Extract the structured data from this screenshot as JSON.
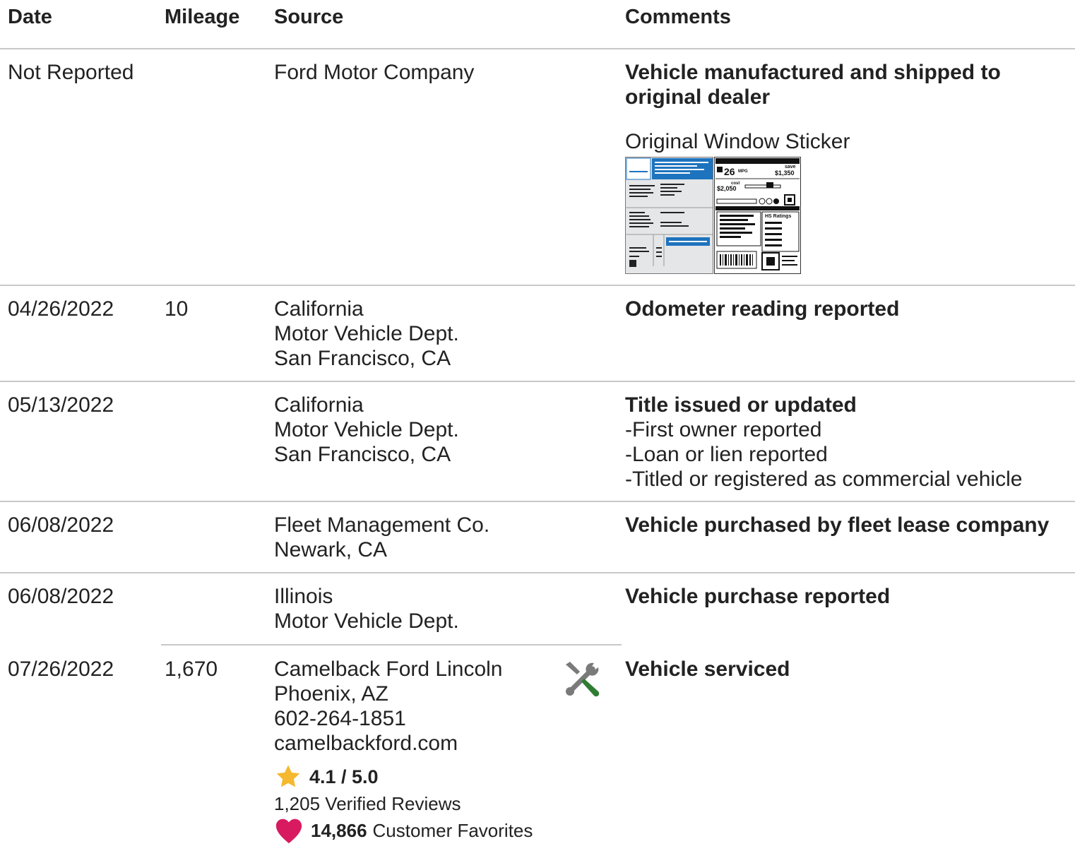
{
  "headers": {
    "date": "Date",
    "mileage": "Mileage",
    "source": "Source",
    "comments": "Comments"
  },
  "rows": [
    {
      "date": "Not Reported",
      "mileage": "",
      "source": [
        "Ford Motor Company"
      ],
      "comment_title": [
        "Vehicle manufactured and shipped to",
        "original dealer"
      ],
      "sticker_label": "Original Window Sticker",
      "sticker": {
        "mpg": "26",
        "mpg_unit": "MPG",
        "save_label": "save",
        "save": "$1,350",
        "cost_label": "cost",
        "cost": "$2,050",
        "ratings_label": "HS Ratings"
      }
    },
    {
      "date": "04/26/2022",
      "mileage": "10",
      "source": [
        "California",
        "Motor Vehicle Dept.",
        "San Francisco, CA"
      ],
      "comment_title": [
        "Odometer reading reported"
      ]
    },
    {
      "date": "05/13/2022",
      "mileage": "",
      "source": [
        "California",
        "Motor Vehicle Dept.",
        "San Francisco, CA"
      ],
      "comment_title": [
        "Title issued or updated"
      ],
      "bullets": [
        "First owner reported",
        "Loan or lien reported",
        "Titled or registered as commercial vehicle"
      ]
    },
    {
      "date": "06/08/2022",
      "mileage": "",
      "source": [
        "Fleet Management Co.",
        "Newark, CA"
      ],
      "comment_title": [
        "Vehicle purchased by fleet lease company"
      ]
    },
    {
      "date": "06/08/2022",
      "mileage": "",
      "source": [
        "Illinois",
        "Motor Vehicle Dept."
      ],
      "comment_title": [
        "Vehicle purchase reported"
      ]
    },
    {
      "date": "07/26/2022",
      "mileage": "1,670",
      "source": [
        "Camelback Ford Lincoln",
        "Phoenix, AZ",
        "602-264-1851",
        "camelbackford.com"
      ],
      "comment_title": [
        "Vehicle serviced"
      ],
      "rating": "4.1 / 5.0",
      "reviews": "1,205 Verified Reviews",
      "favorites_count": "14,866",
      "favorites_label": "Customer Favorites",
      "icon": "service-tools-icon"
    }
  ],
  "colors": {
    "star": "#f5b82e",
    "heart": "#d81b60",
    "sticker_blue": "#1e73be",
    "tool_gray": "#7a7a7a",
    "tool_green": "#2e7d32"
  }
}
